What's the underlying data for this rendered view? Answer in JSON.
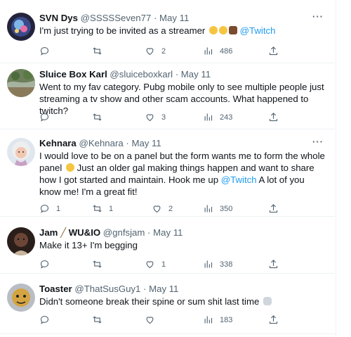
{
  "tweets": [
    {
      "name": "SVN Dys",
      "handle": "@SSSSSeven77",
      "date": "May 11",
      "text": "I'm just trying to be invited as a streamer",
      "mention": "@Twitch",
      "replies": "",
      "retweets": "",
      "likes": "2",
      "views": "486"
    },
    {
      "name": "Sluice Box Karl",
      "handle": "@sluiceboxkarl",
      "date": "May 11",
      "text": "Went to my fav category. Pubg mobile only to see multiple people just streaming a tv show and other scam accounts. What happened to twitch?",
      "replies": "",
      "retweets": "",
      "likes": "3",
      "views": "243"
    },
    {
      "name": "Kehnara",
      "handle": "@Kehnara",
      "date": "May 11",
      "text_before": "I would love to be on a panel but the form wants me to form the whole panel",
      "text_middle": " Just an older gal making things happen and want to share how I got started and maintain. Hook me up ",
      "mention": "@Twitch",
      "text_after": " A lot of you know me! I'm a great fit!",
      "replies": "1",
      "retweets": "1",
      "likes": "2",
      "views": "350"
    },
    {
      "name": "Jam",
      "name_suffix": "WU&IO",
      "handle": "@gnfsjam",
      "date": "May 11",
      "text": "Make it 13+ I'm begging",
      "replies": "",
      "retweets": "",
      "likes": "1",
      "views": "338"
    },
    {
      "name": "Toaster",
      "handle": "@ThatSusGuy1",
      "date": "May 11",
      "text": "Didn't someone break their spine or sum shit last time",
      "replies": "",
      "retweets": "",
      "likes": "",
      "views": "183"
    }
  ],
  "separator": "·",
  "more_label": "···",
  "colors": {
    "accent": "#1d9bf0",
    "muted": "#536471",
    "text": "#0f1419",
    "border": "#eff3f4"
  }
}
